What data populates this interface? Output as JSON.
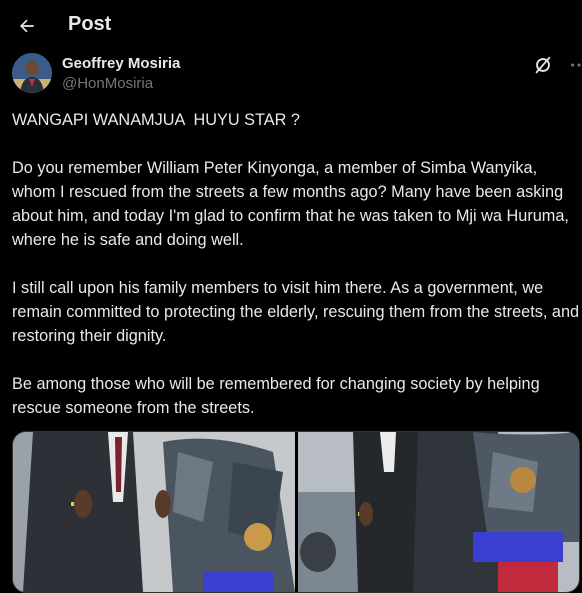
{
  "header": {
    "title": "Post",
    "back_icon": "arrow-left-icon"
  },
  "author": {
    "name": "Geoffrey Mosiria",
    "handle": "@HonMosiria",
    "grok_icon": "grok-icon",
    "more_icon": "more-horizontal-icon"
  },
  "post": {
    "paragraphs": [
      "WANGAPI WANAMJUA  HUYU STAR ?",
      "Do you remember William Peter Kinyonga, a member of Simba Wanyika, whom I rescued from the streets a few months ago? Many have been asking about him, and today I'm glad to confirm that he was taken to Mji wa Huruma, where he is safe and doing well.",
      "I still call upon his family members to visit him there. As a government, we remain committed to protecting the elderly, rescuing them from the streets, and restoring their dignity.",
      "Be among those who will be remembered for changing society by helping rescue someone from the streets."
    ]
  },
  "colors": {
    "background": "#000000",
    "text": "#e7e9ea",
    "secondary": "#71767b"
  }
}
